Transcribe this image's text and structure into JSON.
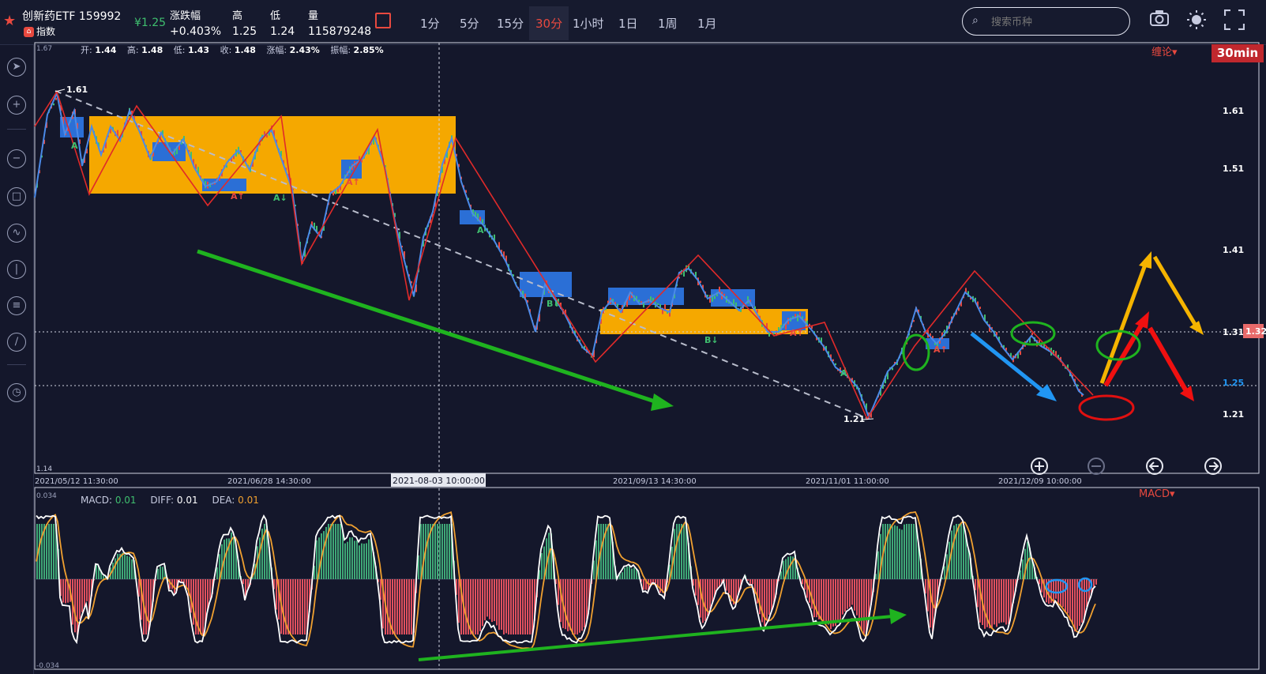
{
  "header": {
    "symbol_name": "创新药ETF 159992",
    "symbol_tag": "指数",
    "price": "¥1.25",
    "stats": [
      {
        "label": "涨跌幅",
        "value": "+0.403%"
      },
      {
        "label": "高",
        "value": "1.25"
      },
      {
        "label": "低",
        "value": "1.24"
      },
      {
        "label": "量",
        "value": "115879248"
      }
    ],
    "periods": [
      "1分",
      "5分",
      "15分",
      "30分",
      "1小时",
      "1日",
      "1周",
      "1月"
    ],
    "active_period": "30分",
    "search_placeholder": "搜索币种"
  },
  "main_chart": {
    "ohlc": [
      {
        "label": "开:",
        "value": "1.44"
      },
      {
        "label": "高:",
        "value": "1.48"
      },
      {
        "label": "低:",
        "value": "1.43"
      },
      {
        "label": "收:",
        "value": "1.48"
      },
      {
        "label": "涨幅:",
        "value": "2.43%"
      },
      {
        "label": "振幅:",
        "value": "2.85%"
      }
    ],
    "indicator_tag": "缠论▾",
    "period_badge": "30min",
    "axis_top": "1.67",
    "axis_bottom": "1.14",
    "price_ticks": [
      "1.61",
      "1.51",
      "1.41",
      "1.31",
      "1.25",
      "1.21"
    ],
    "current_price_tag": "1.32",
    "high_marker": "1.61",
    "low_marker": "1.21",
    "date_ticks": [
      "2021/05/12 11:30:00",
      "2021/06/28 14:30:00",
      "2021/09/13 14:30:00",
      "2021/11/01 11:00:00",
      "2021/12/09 10:00:00"
    ],
    "crosshair_date": "2021-08-03 10:00:00",
    "signal_labels": [
      "A",
      "A↑",
      "A↓",
      "A↑",
      "A",
      "B↓",
      "B↓",
      "A↑",
      "A",
      "A↑"
    ]
  },
  "macd": {
    "indicator_tag": "MACD▾",
    "legend": {
      "macd_label": "MACD:",
      "macd_value": "0.01",
      "diff_label": "DIFF:",
      "diff_value": "0.01",
      "dea_label": "DEA:",
      "dea_value": "0.01"
    },
    "axis_top": "0.034",
    "axis_bottom": "-0.034"
  },
  "chart_data": {
    "type": "line",
    "title": "",
    "series": [
      {
        "values_approx_close": [
          1.47,
          1.58,
          1.61,
          1.52,
          1.48,
          1.56,
          1.59,
          1.52,
          1.48,
          1.53,
          1.57,
          1.49,
          1.46,
          1.55,
          1.59,
          1.5,
          1.4,
          1.44,
          1.5,
          1.56,
          1.44,
          1.36,
          1.45,
          1.56,
          1.45,
          1.4,
          1.34,
          1.37,
          1.32,
          1.28,
          1.38,
          1.32,
          1.4,
          1.33,
          1.31,
          1.36,
          1.3,
          1.25,
          1.21,
          1.29,
          1.34,
          1.3,
          1.38,
          1.33,
          1.31,
          1.34,
          1.28,
          1.25
        ]
      }
    ],
    "ylim": [
      1.14,
      1.67
    ],
    "zones": [
      {
        "from_date_idx": 3,
        "to_date_idx": 23,
        "low": 1.48,
        "high": 1.58,
        "color": "#f5a800"
      },
      {
        "from_date_idx": 28,
        "to_date_idx": 40,
        "low": 1.31,
        "high": 1.34,
        "color": "#f5a800"
      }
    ]
  }
}
